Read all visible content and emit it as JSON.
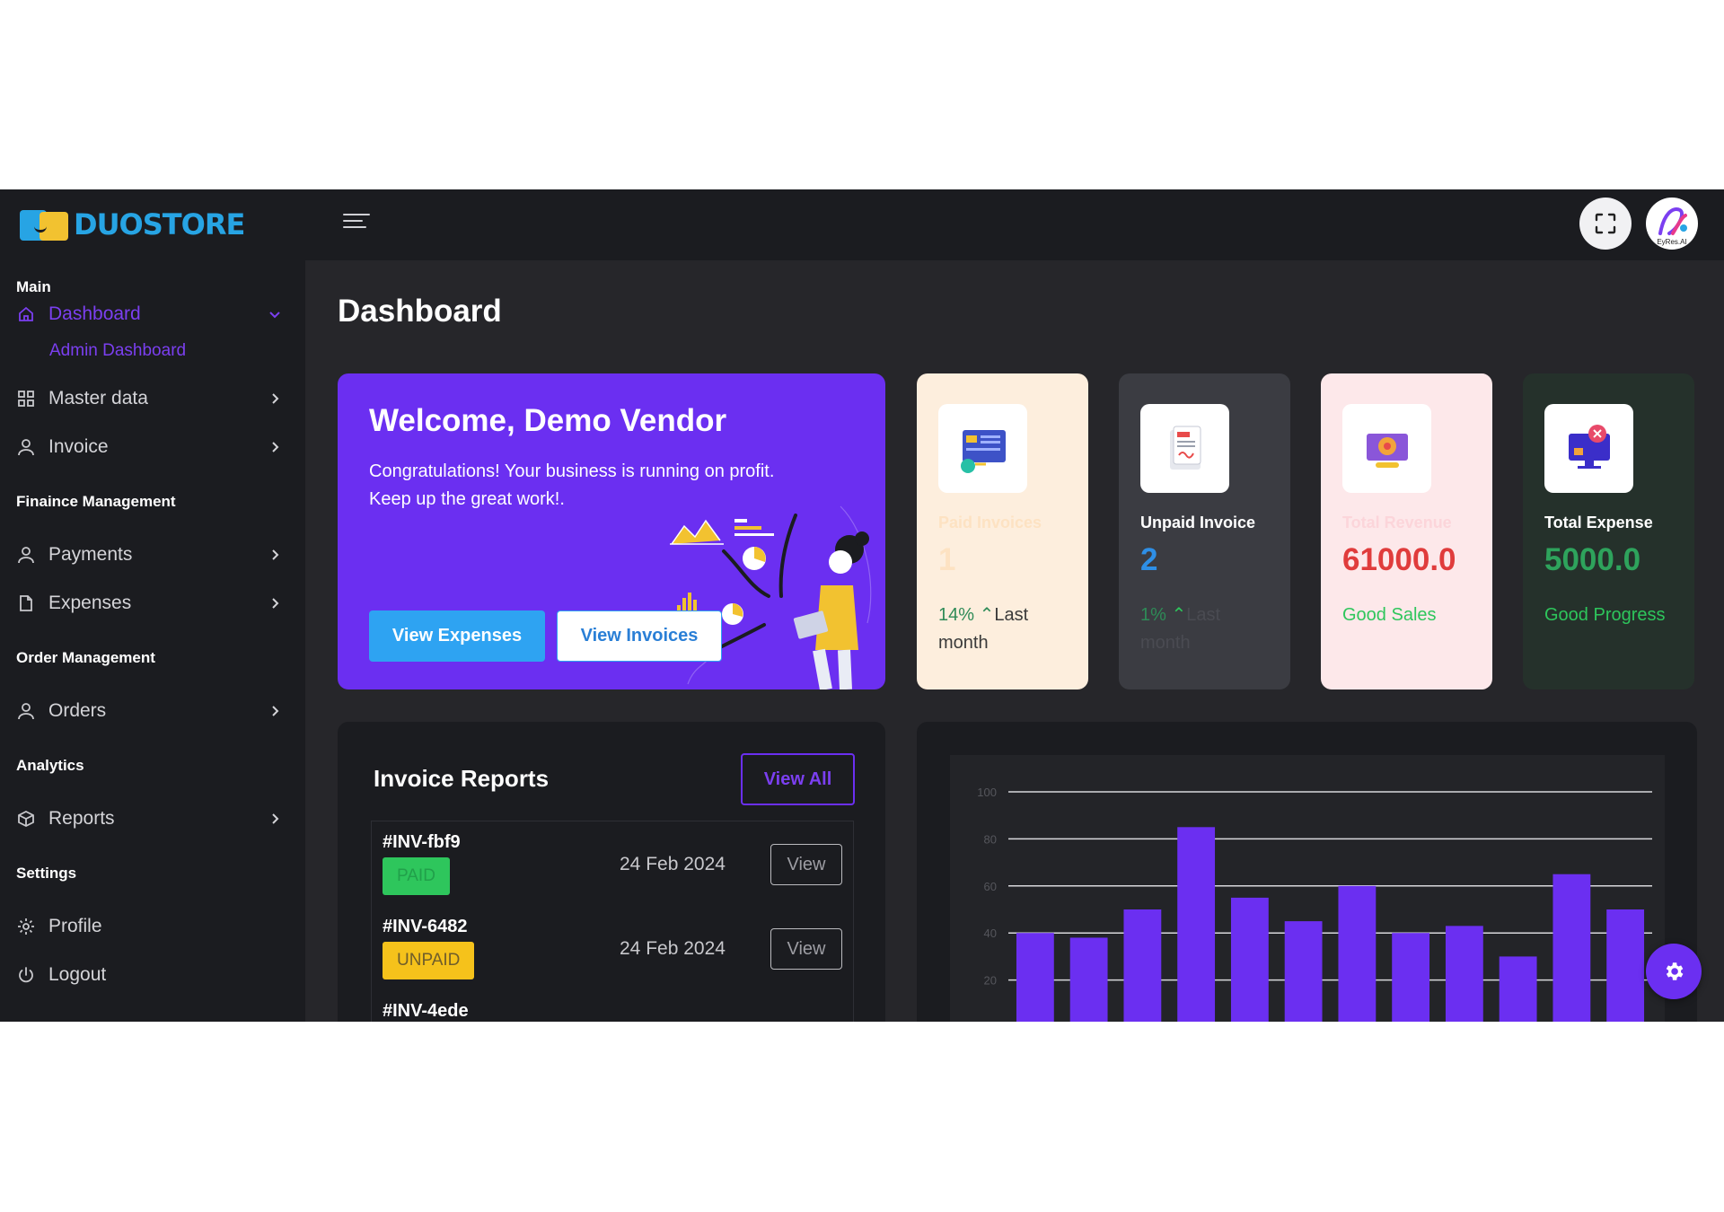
{
  "brand": {
    "name": "DUOSTORE"
  },
  "header": {
    "fullscreen_icon": "fullscreen-icon",
    "avatar_text": "EyRes.AI"
  },
  "sidebar": {
    "sections": {
      "main": "Main",
      "finance": "Finaince Management",
      "order": "Order Management",
      "analytics": "Analytics",
      "settings": "Settings"
    },
    "items": {
      "dashboard": "Dashboard",
      "admin_dashboard": "Admin Dashboard",
      "master_data": "Master data",
      "invoice": "Invoice",
      "payments": "Payments",
      "expenses": "Expenses",
      "orders": "Orders",
      "reports": "Reports",
      "profile": "Profile",
      "logout": "Logout"
    }
  },
  "page": {
    "title": "Dashboard"
  },
  "welcome": {
    "title": "Welcome, Demo Vendor",
    "line1": "Congratulations! Your business is running on profit.",
    "line2": "Keep up the great work!.",
    "btn_expenses": "View Expenses",
    "btn_invoices": "View Invoices"
  },
  "stats": [
    {
      "title": "Paid Invoices",
      "value": "1",
      "note_pct": "14%",
      "note_text": "Last month",
      "bg": "#fdeedd"
    },
    {
      "title": "Unpaid Invoice",
      "value": "2",
      "note_pct": "1%",
      "note_text": "Last month",
      "bg": "#3b3c42"
    },
    {
      "title": "Total Revenue",
      "value": "61000.0",
      "note_text": "Good Sales",
      "bg": "#fde8ea"
    },
    {
      "title": "Total Expense",
      "value": "5000.0",
      "note_text": "Good Progress",
      "bg": "#25312b"
    }
  ],
  "invoice_reports": {
    "title": "Invoice Reports",
    "view_all": "View All",
    "rows": [
      {
        "id": "#INV-fbf9",
        "status": "PAID",
        "date": "24 Feb 2024",
        "action": "View"
      },
      {
        "id": "#INV-6482",
        "status": "UNPAID",
        "date": "24 Feb 2024",
        "action": "View"
      },
      {
        "id": "#INV-4ede",
        "status": "",
        "date": "",
        "action": ""
      }
    ]
  },
  "colors": {
    "accent": "#6b2ff1",
    "bar": "#6b2ff1",
    "paid": "#2ec65c",
    "unpaid": "#f5c21b"
  },
  "chart_data": {
    "type": "bar",
    "ylim": [
      0,
      100
    ],
    "yticks": [
      "100",
      "80",
      "60",
      "40",
      "20"
    ],
    "values": [
      40,
      38,
      50,
      85,
      55,
      45,
      60,
      40,
      43,
      30,
      65,
      50
    ],
    "grid": true
  }
}
